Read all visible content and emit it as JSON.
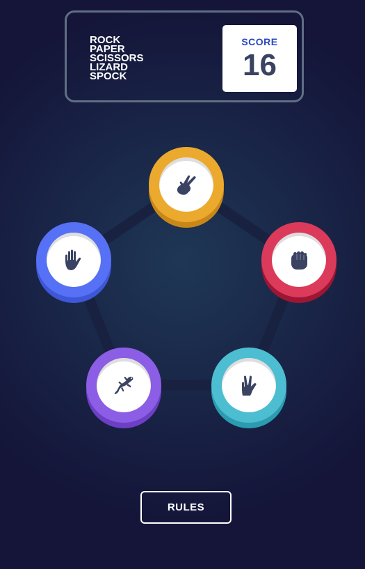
{
  "header": {
    "logo_lines": [
      "ROCK",
      "PAPER",
      "SCISSORS",
      "LIZARD",
      "SPOCK"
    ],
    "score_label": "SCORE",
    "score_value": "16"
  },
  "choices": [
    {
      "name": "scissors",
      "icon": "scissors-hand-icon",
      "color": "#ebaa2d"
    },
    {
      "name": "paper",
      "icon": "paper-hand-icon",
      "color": "#5671f5"
    },
    {
      "name": "rock",
      "icon": "rock-fist-icon",
      "color": "#dc3a5b"
    },
    {
      "name": "lizard",
      "icon": "lizard-icon",
      "color": "#8c5de5"
    },
    {
      "name": "spock",
      "icon": "spock-hand-icon",
      "color": "#4dbdd1"
    }
  ],
  "footer": {
    "rules_label": "RULES"
  },
  "colors": {
    "background": "#1f3756",
    "background_dark": "#141539",
    "score_text": "#2a46c0",
    "dark_text": "#3b4363",
    "header_border": "#606e85"
  }
}
